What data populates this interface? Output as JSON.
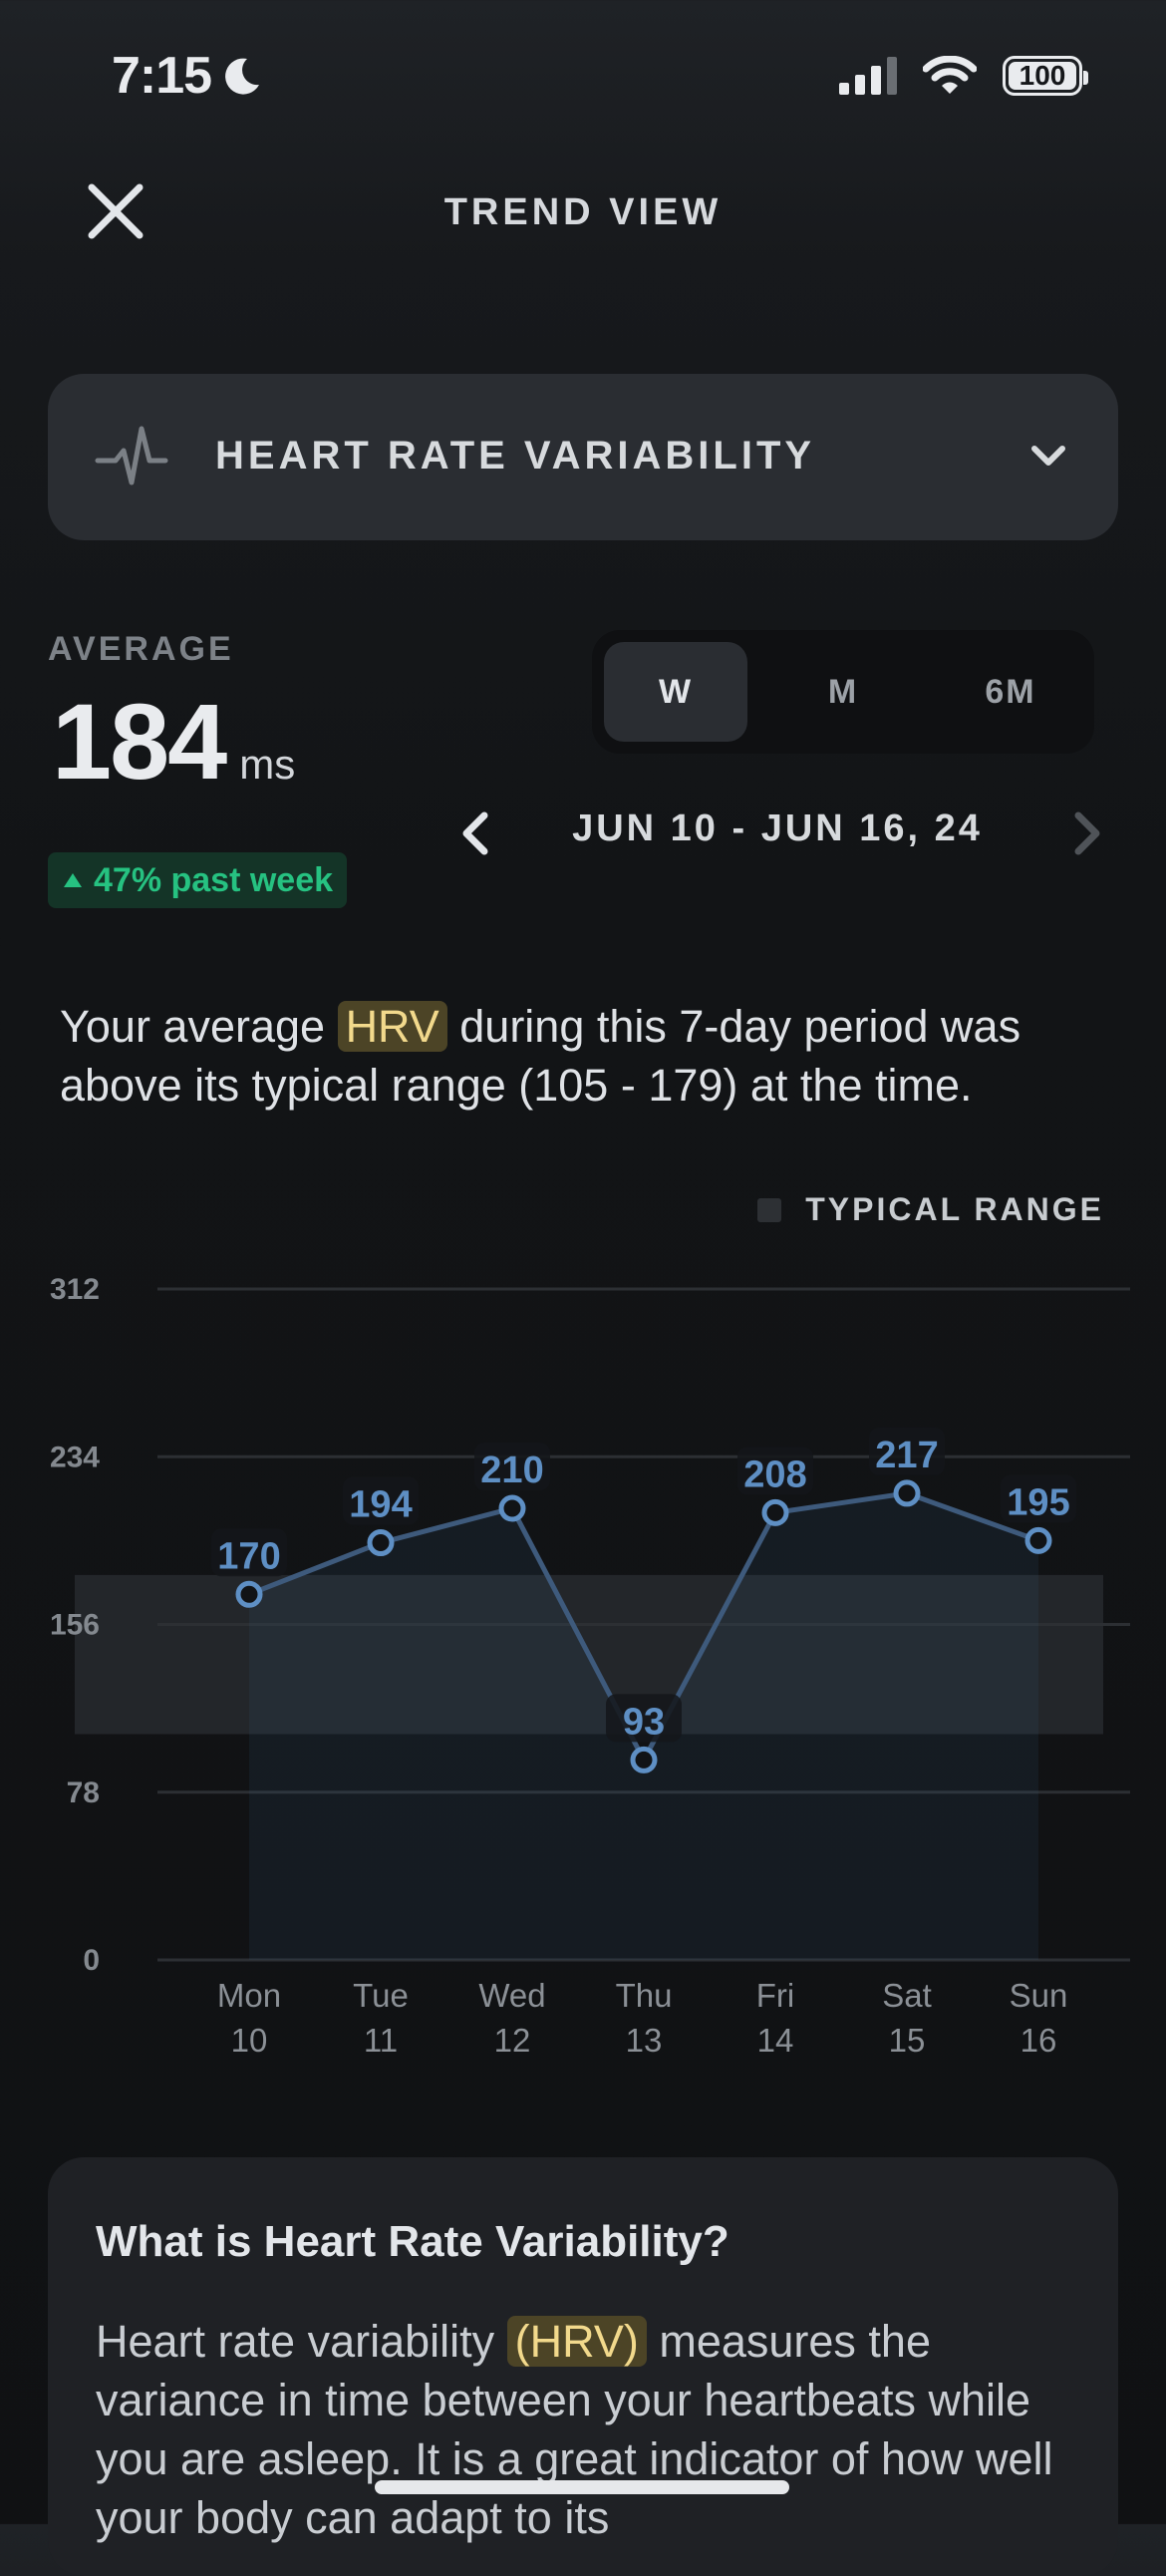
{
  "status_bar": {
    "time": "7:15",
    "battery": "100"
  },
  "header": {
    "title": "TREND VIEW"
  },
  "metric_selector": {
    "label": "HEART RATE VARIABILITY"
  },
  "average": {
    "label": "AVERAGE",
    "value": "184",
    "unit": "ms",
    "change_text": "47% past week",
    "change_color": "#26c281"
  },
  "period": {
    "options": [
      "W",
      "M",
      "6M"
    ],
    "selected": "W",
    "date_range": "JUN 10 - JUN 16, 24"
  },
  "description": {
    "part1": "Your average ",
    "highlight": "HRV",
    "part2": " during this 7-day period was above its typical range (105 - 179) at the time."
  },
  "legend": {
    "label": "TYPICAL RANGE"
  },
  "chart_data": {
    "type": "line",
    "categories": [
      "Mon 10",
      "Tue 11",
      "Wed 12",
      "Thu 13",
      "Fri 14",
      "Sat 15",
      "Sun 16"
    ],
    "x_day": [
      "Mon",
      "Tue",
      "Wed",
      "Thu",
      "Fri",
      "Sat",
      "Sun"
    ],
    "x_date": [
      "10",
      "11",
      "12",
      "13",
      "14",
      "15",
      "16"
    ],
    "values": [
      170,
      194,
      210,
      93,
      208,
      217,
      195
    ],
    "yticks": [
      0,
      78,
      156,
      234,
      312
    ],
    "ylim": [
      0,
      312
    ],
    "typical_range": [
      105,
      179
    ],
    "line_color": "#5e8fc4",
    "grid": true,
    "legend_position": "top-right"
  },
  "info": {
    "title": "What is Heart Rate Variability?",
    "body1": "Heart rate variability ",
    "highlight": "(HRV)",
    "body2": " measures the variance in time between your heartbeats while you are asleep. It is a great indicator of how well your body can adapt to its"
  }
}
